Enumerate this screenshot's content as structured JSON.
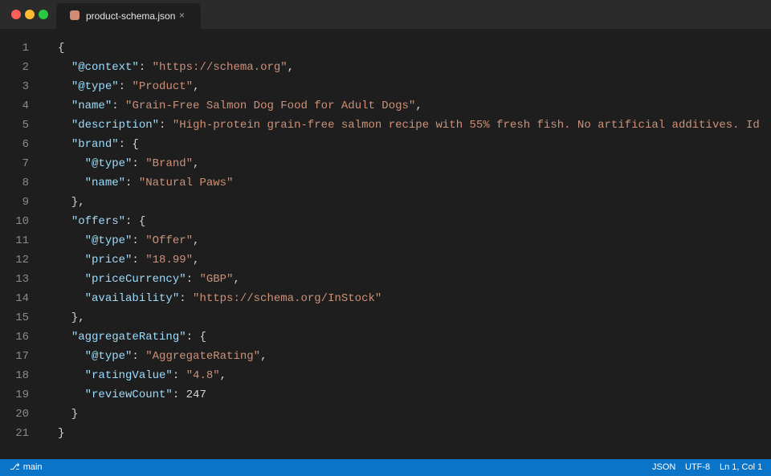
{
  "window": {
    "tab": {
      "filename": "product-schema.json",
      "close_glyph": "×",
      "icon": "json-file-icon",
      "icon_color": "#d08c72"
    }
  },
  "editor": {
    "lines": [
      {
        "num": "1",
        "tokens": [
          {
            "t": "p",
            "v": "{"
          }
        ]
      },
      {
        "num": "2",
        "tokens": [
          {
            "t": "p",
            "v": "  "
          },
          {
            "t": "k",
            "v": "\"@context\""
          },
          {
            "t": "p",
            "v": ": "
          },
          {
            "t": "s",
            "v": "\"https://schema.org\""
          },
          {
            "t": "p",
            "v": ","
          }
        ]
      },
      {
        "num": "3",
        "tokens": [
          {
            "t": "p",
            "v": "  "
          },
          {
            "t": "k",
            "v": "\"@type\""
          },
          {
            "t": "p",
            "v": ": "
          },
          {
            "t": "s",
            "v": "\"Product\""
          },
          {
            "t": "p",
            "v": ","
          }
        ]
      },
      {
        "num": "4",
        "tokens": [
          {
            "t": "p",
            "v": "  "
          },
          {
            "t": "k",
            "v": "\"name\""
          },
          {
            "t": "p",
            "v": ": "
          },
          {
            "t": "s",
            "v": "\"Grain-Free Salmon Dog Food for Adult Dogs\""
          },
          {
            "t": "p",
            "v": ","
          }
        ]
      },
      {
        "num": "5",
        "tokens": [
          {
            "t": "p",
            "v": "  "
          },
          {
            "t": "k",
            "v": "\"description\""
          },
          {
            "t": "p",
            "v": ": "
          },
          {
            "t": "s",
            "v": "\"High-protein grain-free salmon recipe with 55% fresh fish. No artificial additives. Id"
          }
        ]
      },
      {
        "num": "6",
        "tokens": [
          {
            "t": "p",
            "v": "  "
          },
          {
            "t": "k",
            "v": "\"brand\""
          },
          {
            "t": "p",
            "v": ": {"
          }
        ]
      },
      {
        "num": "7",
        "tokens": [
          {
            "t": "p",
            "v": "    "
          },
          {
            "t": "k",
            "v": "\"@type\""
          },
          {
            "t": "p",
            "v": ": "
          },
          {
            "t": "s",
            "v": "\"Brand\""
          },
          {
            "t": "p",
            "v": ","
          }
        ]
      },
      {
        "num": "8",
        "tokens": [
          {
            "t": "p",
            "v": "    "
          },
          {
            "t": "k",
            "v": "\"name\""
          },
          {
            "t": "p",
            "v": ": "
          },
          {
            "t": "s",
            "v": "\"Natural Paws\""
          }
        ]
      },
      {
        "num": "9",
        "tokens": [
          {
            "t": "p",
            "v": "  },"
          }
        ]
      },
      {
        "num": "10",
        "tokens": [
          {
            "t": "p",
            "v": "  "
          },
          {
            "t": "k",
            "v": "\"offers\""
          },
          {
            "t": "p",
            "v": ": {"
          }
        ]
      },
      {
        "num": "11",
        "tokens": [
          {
            "t": "p",
            "v": "    "
          },
          {
            "t": "k",
            "v": "\"@type\""
          },
          {
            "t": "p",
            "v": ": "
          },
          {
            "t": "s",
            "v": "\"Offer\""
          },
          {
            "t": "p",
            "v": ","
          }
        ]
      },
      {
        "num": "12",
        "tokens": [
          {
            "t": "p",
            "v": "    "
          },
          {
            "t": "k",
            "v": "\"price\""
          },
          {
            "t": "p",
            "v": ": "
          },
          {
            "t": "s",
            "v": "\"18.99\""
          },
          {
            "t": "p",
            "v": ","
          }
        ]
      },
      {
        "num": "13",
        "tokens": [
          {
            "t": "p",
            "v": "    "
          },
          {
            "t": "k",
            "v": "\"priceCurrency\""
          },
          {
            "t": "p",
            "v": ": "
          },
          {
            "t": "s",
            "v": "\"GBP\""
          },
          {
            "t": "p",
            "v": ","
          }
        ]
      },
      {
        "num": "14",
        "tokens": [
          {
            "t": "p",
            "v": "    "
          },
          {
            "t": "k",
            "v": "\"availability\""
          },
          {
            "t": "p",
            "v": ": "
          },
          {
            "t": "s",
            "v": "\"https://schema.org/InStock\""
          }
        ]
      },
      {
        "num": "15",
        "tokens": [
          {
            "t": "p",
            "v": "  },"
          }
        ]
      },
      {
        "num": "16",
        "tokens": [
          {
            "t": "p",
            "v": "  "
          },
          {
            "t": "k",
            "v": "\"aggregateRating\""
          },
          {
            "t": "p",
            "v": ": {"
          }
        ]
      },
      {
        "num": "17",
        "tokens": [
          {
            "t": "p",
            "v": "    "
          },
          {
            "t": "k",
            "v": "\"@type\""
          },
          {
            "t": "p",
            "v": ": "
          },
          {
            "t": "s",
            "v": "\"AggregateRating\""
          },
          {
            "t": "p",
            "v": ","
          }
        ]
      },
      {
        "num": "18",
        "tokens": [
          {
            "t": "p",
            "v": "    "
          },
          {
            "t": "k",
            "v": "\"ratingValue\""
          },
          {
            "t": "p",
            "v": ": "
          },
          {
            "t": "s",
            "v": "\"4.8\""
          },
          {
            "t": "p",
            "v": ","
          }
        ]
      },
      {
        "num": "19",
        "tokens": [
          {
            "t": "p",
            "v": "    "
          },
          {
            "t": "k",
            "v": "\"reviewCount\""
          },
          {
            "t": "p",
            "v": ": "
          },
          {
            "t": "n",
            "v": "247"
          }
        ]
      },
      {
        "num": "20",
        "tokens": [
          {
            "t": "p",
            "v": "  }"
          }
        ]
      },
      {
        "num": "21",
        "tokens": [
          {
            "t": "p",
            "v": "}"
          }
        ]
      }
    ]
  },
  "statusbar": {
    "branch_icon": "git-branch-icon",
    "branch_glyph": "⎇",
    "branch": "main",
    "language": "JSON",
    "encoding": "UTF-8",
    "position": "Ln 1, Col 1",
    "color": "#0a74c9"
  }
}
